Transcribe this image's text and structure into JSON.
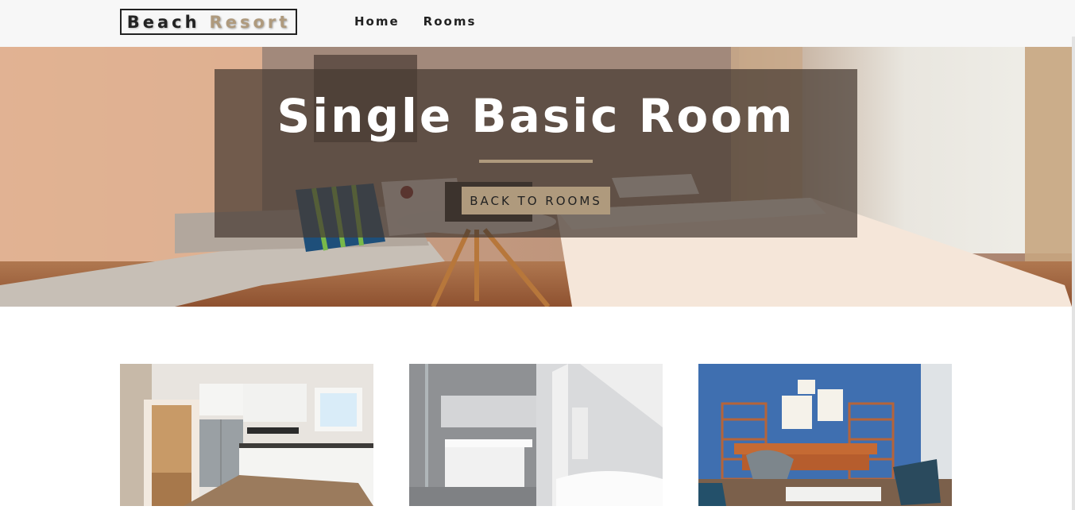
{
  "navbar": {
    "logo": {
      "part1": "Beach",
      "part2": "Resort"
    },
    "links": [
      {
        "label": "Home"
      },
      {
        "label": "Rooms"
      }
    ]
  },
  "hero": {
    "title": "Single Basic Room",
    "button_label": "BACK TO ROOMS"
  },
  "gallery": {
    "images": [
      {
        "subject": "kitchen"
      },
      {
        "subject": "bathroom"
      },
      {
        "subject": "blue-living-room"
      }
    ]
  },
  "colors": {
    "accent": "#af9a7d",
    "navbar_bg": "#f7f7f7",
    "text_dark": "#222222",
    "banner_overlay": "rgba(70,58,50,0.72)"
  }
}
